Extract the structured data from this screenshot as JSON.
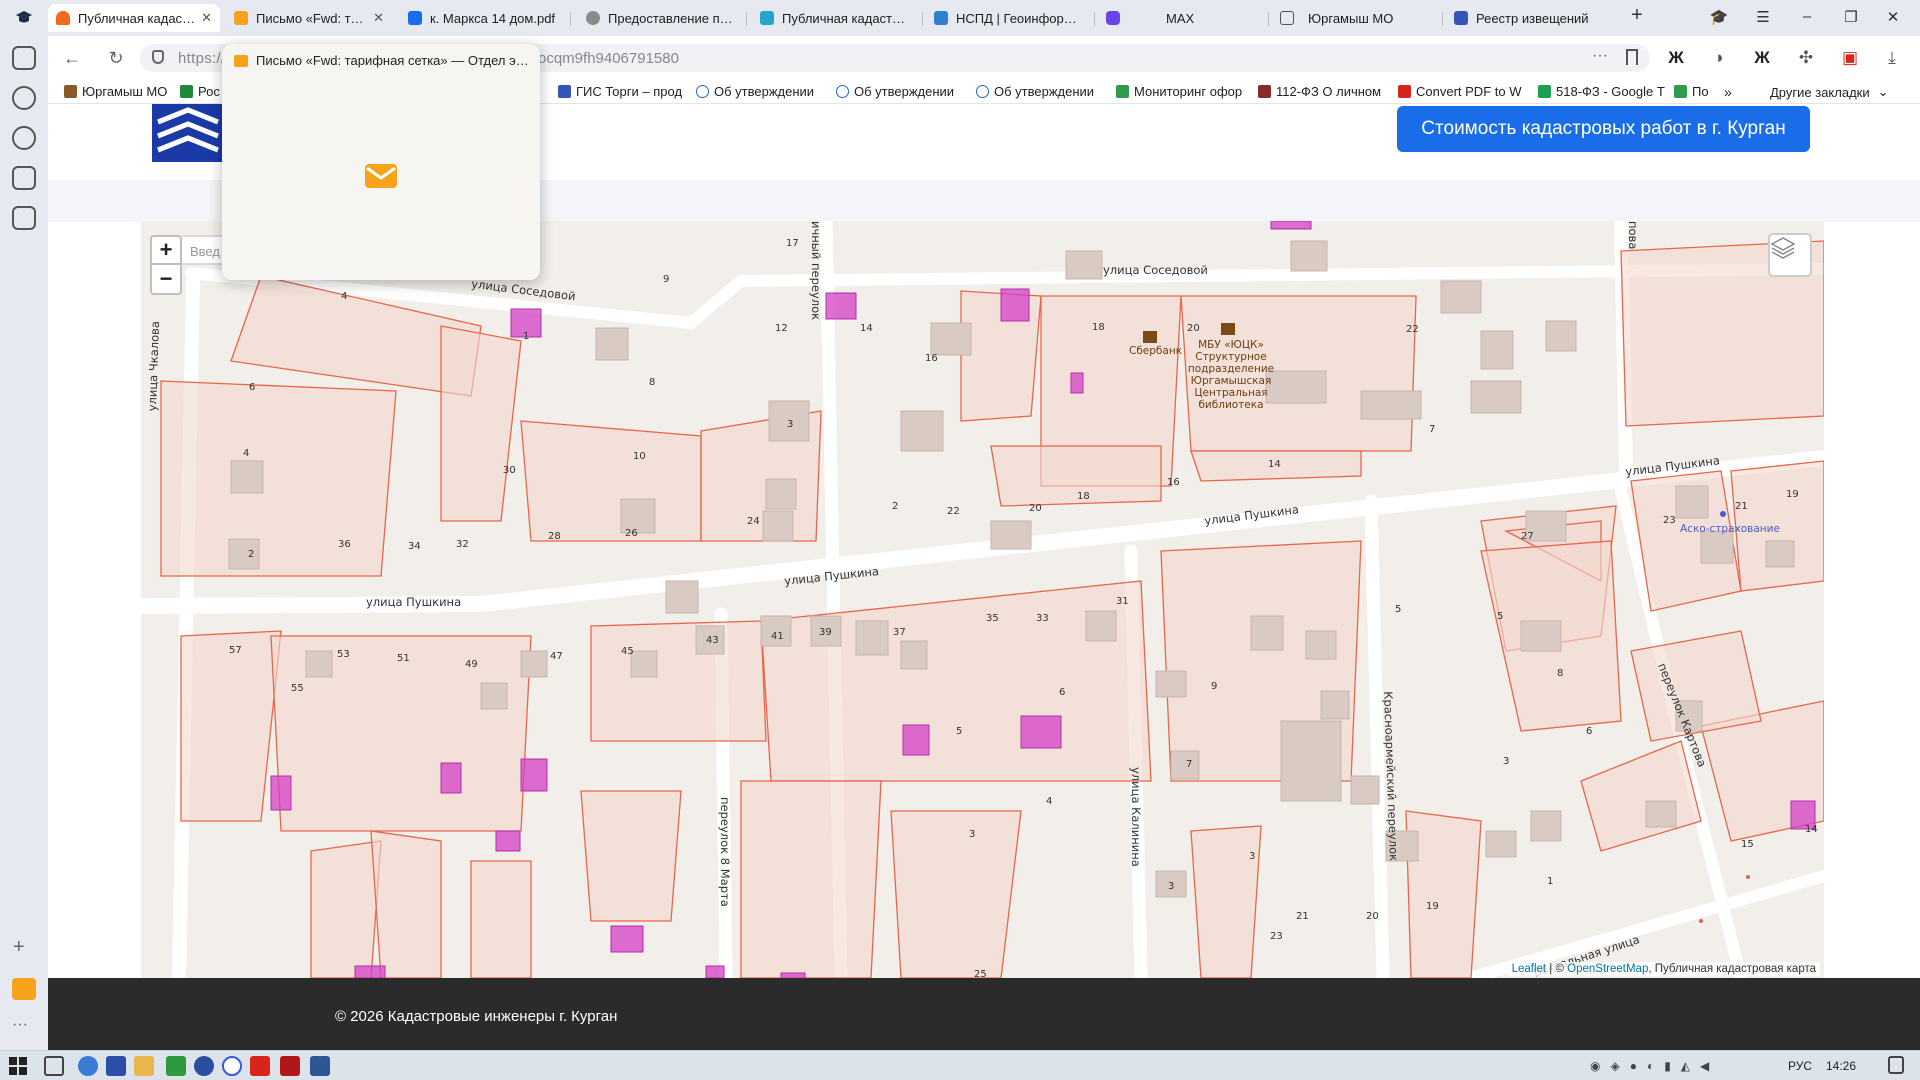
{
  "browser": {
    "tabs": [
      {
        "label": "Публичная кадастровая карта",
        "active": true,
        "icon": "home-orange-icon",
        "color": "#f26b1d",
        "closable": true
      },
      {
        "label": "Письмо «Fwd: тарифная сетка»",
        "active": false,
        "icon": "mail-icon",
        "color": "#f7a21b",
        "closable": true
      },
      {
        "label": "к. Маркса 14 дом.pdf",
        "active": false,
        "icon": "document-blue-icon",
        "color": "#1a6de9",
        "closable": false
      },
      {
        "label": "Предоставление под",
        "active": false,
        "icon": "gosuslugi-icon",
        "color": "#8a8a8a",
        "closable": false
      },
      {
        "label": "Публичная кадастровая",
        "active": false,
        "icon": "kadastr-icon",
        "color": "#27a4c9",
        "closable": false
      },
      {
        "label": "НСПД | Геоинформац",
        "active": false,
        "icon": "nspd-icon",
        "color": "#2d7fd1",
        "closable": false
      },
      {
        "label": "MAX",
        "active": false,
        "icon": "max-icon",
        "color": "#6b44e6",
        "closable": false
      },
      {
        "label": "Юргамыш МО",
        "active": false,
        "icon": "document-icon",
        "color": "#555555",
        "closable": false
      },
      {
        "label": "Реестр извещений",
        "active": false,
        "icon": "emblem-icon",
        "color": "#3456b8",
        "closable": false
      }
    ],
    "url_prefix": "https://",
    "url_tail": "ocqm9fh9406791580",
    "bookmarks": [
      {
        "label": "Юргамыш МО",
        "icon": "bookmark-emblem-icon",
        "color": "#8a5a2a"
      },
      {
        "label": "Рос",
        "icon": "bookmark-ros-icon",
        "color": "#1f8a3a"
      },
      {
        "label": "ГИС Торги – прод",
        "icon": "bookmark-emblem-icon",
        "color": "#3456b8"
      },
      {
        "label": "Об утверждении",
        "icon": "bookmark-consultant-icon",
        "color": "#2266cc"
      },
      {
        "label": "Об утверждении",
        "icon": "bookmark-consultant-icon",
        "color": "#2266cc"
      },
      {
        "label": "Об утверждении",
        "icon": "bookmark-consultant-icon",
        "color": "#2266cc"
      },
      {
        "label": "Мониторинг офор",
        "icon": "bookmark-monitor-icon",
        "color": "#2e9c4a"
      },
      {
        "label": "112-ФЗ О личном",
        "icon": "bookmark-book-icon",
        "color": "#8a2a2a"
      },
      {
        "label": "Convert PDF to W",
        "icon": "bookmark-pdf-icon",
        "color": "#d8251c"
      },
      {
        "label": "518-ФЗ - Google Т",
        "icon": "bookmark-sheets-icon",
        "color": "#1e9e52"
      },
      {
        "label": "По",
        "icon": "bookmark-monitor-icon",
        "color": "#2e9c4a"
      }
    ],
    "other_bookmarks": "Другие закладки",
    "popover_title": "Письмо «Fwd: тарифная сетка» — Отдел экономики..."
  },
  "page": {
    "cta": "Стоимость кадастровых работ в г. Курган",
    "search_placeholder": "Введ",
    "zoom_in": "+",
    "zoom_out": "−",
    "attribution": {
      "leaflet": "Leaflet",
      "sep": " | © ",
      "osm": "OpenStreetMap",
      "rest": ", Публичная кадастровая карта"
    },
    "copyright": "© 2026 Кадастровые инженеры г. Курган"
  },
  "map": {
    "streets": {
      "sosedovoy_1": "улица Соседовой",
      "sosedovoy_2": "улица Соседовой",
      "chkalova": "улица Чкалова",
      "pushkina_1": "улица Пушкина",
      "pushkina_2": "улица Пушкина",
      "pushkina_3": "улица Пушкина",
      "pushkina_4": "улица Пушкина",
      "pereulok_top": "ичный переулок",
      "marta": "переулок 8 Марта",
      "kalinina": "улица Калинина",
      "krasnoarm": "Красноармейский переулок",
      "kartova": "переулок Картова",
      "vokzalnaya": "Вокзальная улица",
      "right_top": "пова"
    },
    "pois": {
      "sberbank": "Сбербанк",
      "library": [
        "МБУ «ЮЦК»",
        "Структурное",
        "подразделение",
        "Юргамышская",
        "Центральная",
        "библиотека"
      ],
      "asko": "Аско-страхование"
    },
    "house_numbers": [
      "17",
      "9",
      "4",
      "1",
      "6",
      "8",
      "12",
      "3",
      "14",
      "16",
      "18",
      "20",
      "22",
      "4",
      "30",
      "10",
      "24",
      "7",
      "2",
      "36",
      "34",
      "32",
      "28",
      "26",
      "2",
      "22",
      "20",
      "18",
      "16",
      "14",
      "27",
      "23",
      "21",
      "19",
      "57",
      "55",
      "53",
      "51",
      "49",
      "47",
      "45",
      "43",
      "41",
      "39",
      "37",
      "35",
      "33",
      "31",
      "5",
      "8",
      "6",
      "5",
      "3",
      "4",
      "3",
      "6",
      "9",
      "3",
      "21",
      "20",
      "19",
      "1",
      "15",
      "14",
      "5",
      "3",
      "23",
      "25",
      "7"
    ]
  },
  "taskbar": {
    "lang": "РУС",
    "time": "14:26"
  },
  "colors": {
    "accent": "#1a6de9",
    "parcel_stroke": "#e8664c",
    "parcel_fill": "#f4d9cf",
    "highlight": "#d43fc6",
    "footer": "#2b2b2b"
  }
}
